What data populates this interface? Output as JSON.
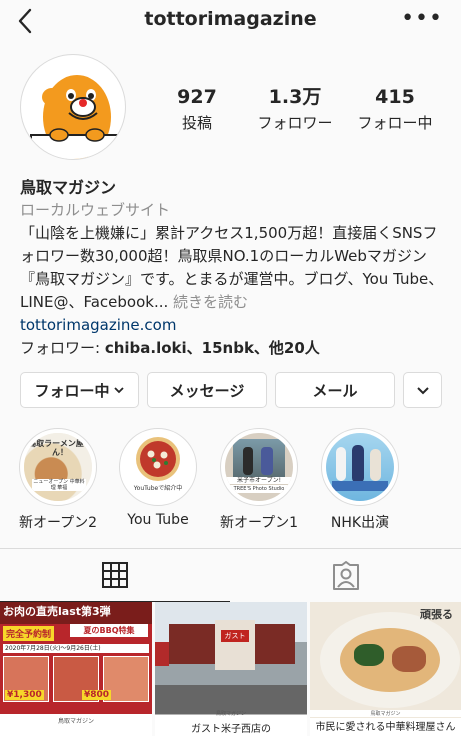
{
  "header": {
    "username": "tottorimagazine",
    "back_icon": "chevron-left-icon",
    "more_icon": "ellipsis-icon",
    "more_glyph": "•••"
  },
  "profile": {
    "stats": [
      {
        "value": "927",
        "label": "投稿"
      },
      {
        "value": "1.3万",
        "label": "フォロワー"
      },
      {
        "value": "415",
        "label": "フォロー中"
      }
    ],
    "display_name": "鳥取マガジン",
    "category": "ローカルウェブサイト",
    "bio_text": "「山陰を上機嫌に」累計アクセス1,500万超！直接届くSNSフォロワー数30,000超！鳥取県NO.1のローカルWebマガジン『鳥取マガジン』です。とまるが運営中。ブログ、You Tube、LINE@、Facebook...",
    "bio_more": " 続きを読む",
    "website": "tottorimagazine.com",
    "followed_by_prefix": "フォロワー: ",
    "followed_by_names": "chiba.loki、15nbk、他20人"
  },
  "actions": {
    "following": "フォロー中",
    "message": "メッセージ",
    "email": "メール"
  },
  "highlights": [
    {
      "label": "新オープン2",
      "overlay": "鳥取ラーメン屋さん！",
      "sub": "ニューオープン\n中華料理 華福"
    },
    {
      "label": "You Tube",
      "overlay": "YouTubeで紹介中"
    },
    {
      "label": "新オープン1",
      "overlay": "米子市オープン!",
      "sub": "TREE'S Photo Studio"
    },
    {
      "label": "NHK出演",
      "overlay": ""
    }
  ],
  "tabs": {
    "grid_icon": "grid-icon",
    "tagged_icon": "tagged-person-icon"
  },
  "posts": [
    {
      "headline": "お肉の直売last第3弾",
      "badge": "完全予約制",
      "date": "2020年7月28日(火)〜9月26日(土)",
      "special": "夏のBBQ特集",
      "price1": "¥1,300",
      "price2": "¥800",
      "footer": "鳥取マガジン"
    },
    {
      "sign": "ガスト",
      "footer_small": "鳥取マガジン",
      "caption": "ガスト米子西店の"
    },
    {
      "shop_sign": "頑張る",
      "footer_small": "鳥取マガジン",
      "caption": "市民に愛される中華料理屋さん"
    }
  ],
  "colors": {
    "text": "#262626",
    "muted": "#8e8e8e",
    "link": "#00376b",
    "border": "#dbdbdb",
    "mascot": "#f39a1e"
  }
}
